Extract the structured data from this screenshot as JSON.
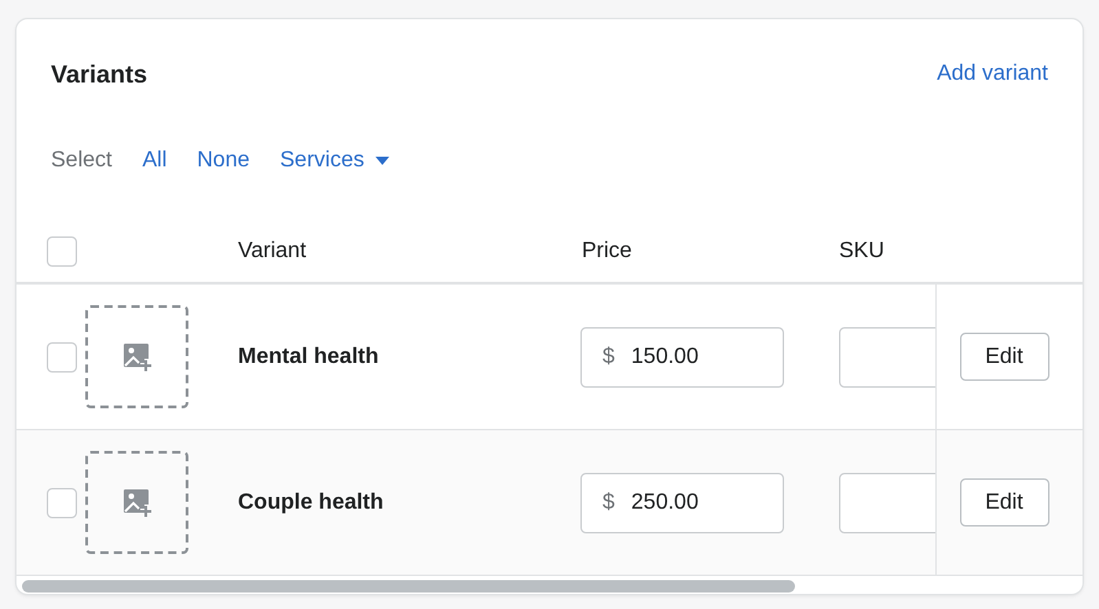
{
  "card": {
    "title": "Variants",
    "action": "Add variant"
  },
  "select_bar": {
    "label": "Select",
    "options": [
      {
        "label": "All",
        "dropdown": false
      },
      {
        "label": "None",
        "dropdown": false
      },
      {
        "label": "Services",
        "dropdown": true
      }
    ]
  },
  "table": {
    "select_all_checked": false,
    "columns": [
      "Variant",
      "Price",
      "SKU"
    ],
    "rows": [
      {
        "checked": false,
        "name": "Mental health",
        "currency": "$",
        "price": "150.00",
        "action": "Edit"
      },
      {
        "checked": false,
        "name": "Couple health",
        "currency": "$",
        "price": "250.00",
        "action": "Edit"
      }
    ]
  }
}
